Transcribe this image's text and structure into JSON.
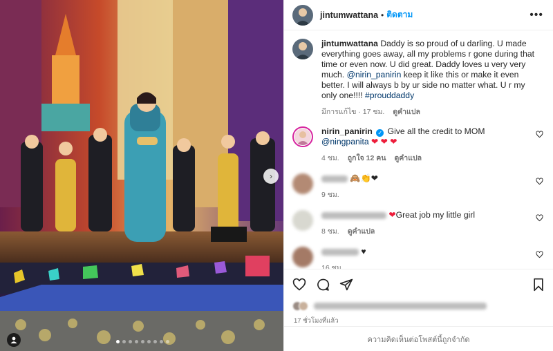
{
  "post": {
    "username": "jintumwattana",
    "separator": "•",
    "follow_label": "ติดตาม",
    "more_icon": "more-horizontal-icon"
  },
  "caption": {
    "username": "jintumwattana",
    "text_1": "Daddy is so proud of u darling. U made everything goes away, all my problems r gone during that time or even now. U did great. Daddy loves u very very much.",
    "mention": "@nirin_panirin",
    "text_2": "keep it like this or make it even better. I will always b by ur side no matter what. U r my only one!!!!",
    "hashtag": "#prouddaddy",
    "edited": "มีการแก้ไข",
    "time": "17 ชม.",
    "translate": "ดูคำแปล"
  },
  "comments": [
    {
      "username": "nirin_panirin",
      "text": "Give all the credit to MOM",
      "mention": "@ningpanita",
      "emoji": "❤ ❤ ❤",
      "time": "4 ชม.",
      "likes": "ถูกใจ 12 คน",
      "translate": "ดูคำแปล"
    },
    {
      "emoji": "🙈👏❤",
      "time": "9 ชม."
    },
    {
      "emoji": "❤",
      "text": "Great job my little girl",
      "time": "8 ชม.",
      "translate": "ดูคำแปล"
    },
    {
      "emoji": "♥",
      "time": "16 ชม."
    }
  ],
  "footer": {
    "posted_time": "17 ชั่วโมงที่แล้ว",
    "comments_closed": "ความคิดเห็นต่อโพสต์นี้ถูกจำกัด"
  },
  "colors": {
    "link": "#00376b",
    "follow": "#0095f6",
    "muted": "#737373",
    "heart": "#ed1c3a"
  }
}
